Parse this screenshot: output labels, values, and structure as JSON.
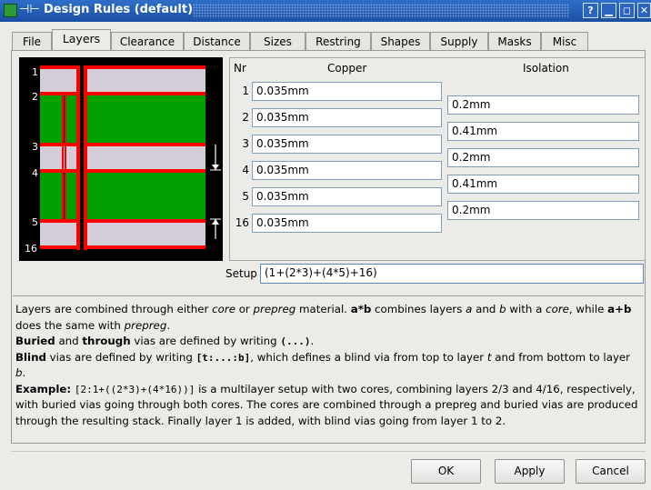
{
  "window": {
    "title": "Design Rules (default)",
    "controls": [
      "?",
      "▁",
      "◻",
      "✕"
    ]
  },
  "tabs": [
    {
      "label": "File",
      "active": false
    },
    {
      "label": "Layers",
      "active": true
    },
    {
      "label": "Clearance",
      "active": false
    },
    {
      "label": "Distance",
      "active": false
    },
    {
      "label": "Sizes",
      "active": false
    },
    {
      "label": "Restring",
      "active": false
    },
    {
      "label": "Shapes",
      "active": false
    },
    {
      "label": "Supply",
      "active": false
    },
    {
      "label": "Masks",
      "active": false
    },
    {
      "label": "Misc",
      "active": false
    }
  ],
  "stack_labels": [
    "1",
    "2",
    "3",
    "4",
    "5",
    "16"
  ],
  "table": {
    "nr_header": "Nr",
    "copper_header": "Copper",
    "isolation_header": "Isolation",
    "copper_rows": [
      {
        "nr": "1",
        "value": "0.035mm"
      },
      {
        "nr": "2",
        "value": "0.035mm"
      },
      {
        "nr": "3",
        "value": "0.035mm"
      },
      {
        "nr": "4",
        "value": "0.035mm"
      },
      {
        "nr": "5",
        "value": "0.035mm"
      },
      {
        "nr": "16",
        "value": "0.035mm"
      }
    ],
    "isolation_values": [
      "0.2mm",
      "0.41mm",
      "0.2mm",
      "0.41mm",
      "0.2mm"
    ]
  },
  "setup": {
    "label": "Setup",
    "value": "(1+(2*3)+(4*5)+16)"
  },
  "help": {
    "p1_a": "Layers are combined through either ",
    "p1_core": "core",
    "p1_b": " or ",
    "p1_prepreg": "prepreg",
    "p1_c": " material. ",
    "p1_axb": "a*b",
    "p1_d": " combines layers ",
    "p1_a_var": "a",
    "p1_e": " and ",
    "p1_b_var": "b",
    "p1_f": " with a ",
    "p1_core2": "core",
    "p1_g": ", while ",
    "p1_apb": "a+b",
    "p1_h": " does the same with ",
    "p1_prepreg2": "prepreg",
    "p1_i": ".",
    "p2_buried": "Buried",
    "p2_a": " and ",
    "p2_through": "through",
    "p2_b": " vias are defined by writing ",
    "p2_code": "(...)",
    "p2_c": ".",
    "p3_blind": "Blind",
    "p3_a": " vias are defined by writing ",
    "p3_code": "[t:...:b]",
    "p3_b": ", which defines a blind via from top to layer ",
    "p3_t": "t",
    "p3_c": " and from bottom to layer ",
    "p3_bvar": "b",
    "p3_d": ".",
    "p4_example": "Example:",
    "p4_code": "[2:1+((2*3)+(4*16))]",
    "p4_text": " is a multilayer setup with two cores, combining layers 2/3 and 4/16, respectively, with buried vias going through both cores. The cores are combined through a prepreg and buried vias are produced through the resulting stack. Finally layer 1 is added, with blind vias going from layer 1 to 2."
  },
  "buttons": {
    "ok": "OK",
    "apply": "Apply",
    "cancel": "Cancel"
  },
  "colors": {
    "copper": "#ff0000",
    "core": "#00a000",
    "prepreg": "#d4ccd6",
    "background": "#000000"
  }
}
